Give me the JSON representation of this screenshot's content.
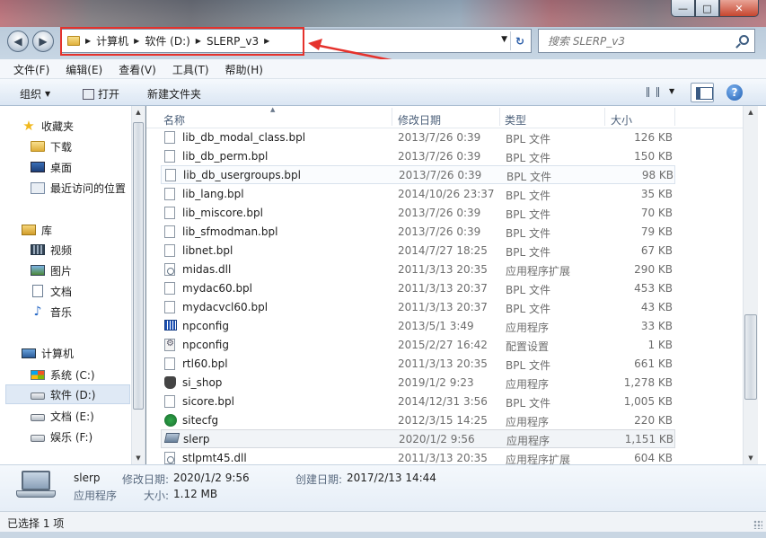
{
  "window": {
    "min": "—",
    "max": "□",
    "close": "✕"
  },
  "address": {
    "crumbs": [
      "计算机",
      "软件 (D:)",
      "SLERP_v3"
    ]
  },
  "search": {
    "placeholder": "搜索 SLERP_v3"
  },
  "menu": [
    "文件(F)",
    "编辑(E)",
    "查看(V)",
    "工具(T)",
    "帮助(H)"
  ],
  "toolbar": {
    "organize": "组织",
    "open": "打开",
    "new_folder": "新建文件夹"
  },
  "nav": {
    "favorites": "收藏夹",
    "downloads": "下载",
    "desktop": "桌面",
    "recent": "最近访问的位置",
    "libraries": "库",
    "videos": "视频",
    "pictures": "图片",
    "documents": "文档",
    "music": "音乐",
    "computer": "计算机",
    "drive_c": "系统 (C:)",
    "drive_d": "软件 (D:)",
    "drive_e": "文档 (E:)",
    "drive_f": "娱乐 (F:)"
  },
  "columns": {
    "name": "名称",
    "date": "修改日期",
    "type": "类型",
    "size": "大小"
  },
  "files": [
    {
      "name": "lib_db_modal_class.bpl",
      "date": "2013/7/26 0:39",
      "type": "BPL 文件",
      "size": "126 KB",
      "icon": "bpl-file-icon"
    },
    {
      "name": "lib_db_perm.bpl",
      "date": "2013/7/26 0:39",
      "type": "BPL 文件",
      "size": "150 KB",
      "icon": "bpl-file-icon"
    },
    {
      "name": "lib_db_usergroups.bpl",
      "date": "2013/7/26 0:39",
      "type": "BPL 文件",
      "size": "98 KB",
      "icon": "bpl-file-icon"
    },
    {
      "name": "lib_lang.bpl",
      "date": "2014/10/26 23:37",
      "type": "BPL 文件",
      "size": "35 KB",
      "icon": "bpl-file-icon"
    },
    {
      "name": "lib_miscore.bpl",
      "date": "2013/7/26 0:39",
      "type": "BPL 文件",
      "size": "70 KB",
      "icon": "bpl-file-icon"
    },
    {
      "name": "lib_sfmodman.bpl",
      "date": "2013/7/26 0:39",
      "type": "BPL 文件",
      "size": "79 KB",
      "icon": "bpl-file-icon"
    },
    {
      "name": "libnet.bpl",
      "date": "2014/7/27 18:25",
      "type": "BPL 文件",
      "size": "67 KB",
      "icon": "bpl-file-icon"
    },
    {
      "name": "midas.dll",
      "date": "2011/3/13 20:35",
      "type": "应用程序扩展",
      "size": "290 KB",
      "icon": "dll-file-icon"
    },
    {
      "name": "mydac60.bpl",
      "date": "2011/3/13 20:37",
      "type": "BPL 文件",
      "size": "453 KB",
      "icon": "bpl-file-icon"
    },
    {
      "name": "mydacvcl60.bpl",
      "date": "2011/3/13 20:37",
      "type": "BPL 文件",
      "size": "43 KB",
      "icon": "bpl-file-icon"
    },
    {
      "name": "npconfig",
      "date": "2013/5/1 3:49",
      "type": "应用程序",
      "size": "33 KB",
      "icon": "npconfig-app-icon"
    },
    {
      "name": "npconfig",
      "date": "2015/2/27 16:42",
      "type": "配置设置",
      "size": "1 KB",
      "icon": "config-file-icon"
    },
    {
      "name": "rtl60.bpl",
      "date": "2011/3/13 20:35",
      "type": "BPL 文件",
      "size": "661 KB",
      "icon": "bpl-file-icon"
    },
    {
      "name": "si_shop",
      "date": "2019/1/2 9:23",
      "type": "应用程序",
      "size": "1,278 KB",
      "icon": "si-shop-app-icon"
    },
    {
      "name": "sicore.bpl",
      "date": "2014/12/31 3:56",
      "type": "BPL 文件",
      "size": "1,005 KB",
      "icon": "bpl-file-icon"
    },
    {
      "name": "sitecfg",
      "date": "2012/3/15 14:25",
      "type": "应用程序",
      "size": "220 KB",
      "icon": "sitecfg-app-icon"
    },
    {
      "name": "slerp",
      "date": "2020/1/2 9:56",
      "type": "应用程序",
      "size": "1,151 KB",
      "icon": "slerp-app-icon"
    },
    {
      "name": "stlpmt45.dll",
      "date": "2011/3/13 20:35",
      "type": "应用程序扩展",
      "size": "604 KB",
      "icon": "dll-file-icon"
    }
  ],
  "details": {
    "name": "slerp",
    "kind": "应用程序",
    "modified_label": "修改日期:",
    "modified": "2020/1/2 9:56",
    "created_label": "创建日期:",
    "created": "2017/2/13 14:44",
    "size_label": "大小:",
    "size": "1.12 MB"
  },
  "status": {
    "selected": "已选择 1 项"
  },
  "colors": {
    "annotation_red": "#e5322c",
    "selection": "#dfe9f5"
  }
}
